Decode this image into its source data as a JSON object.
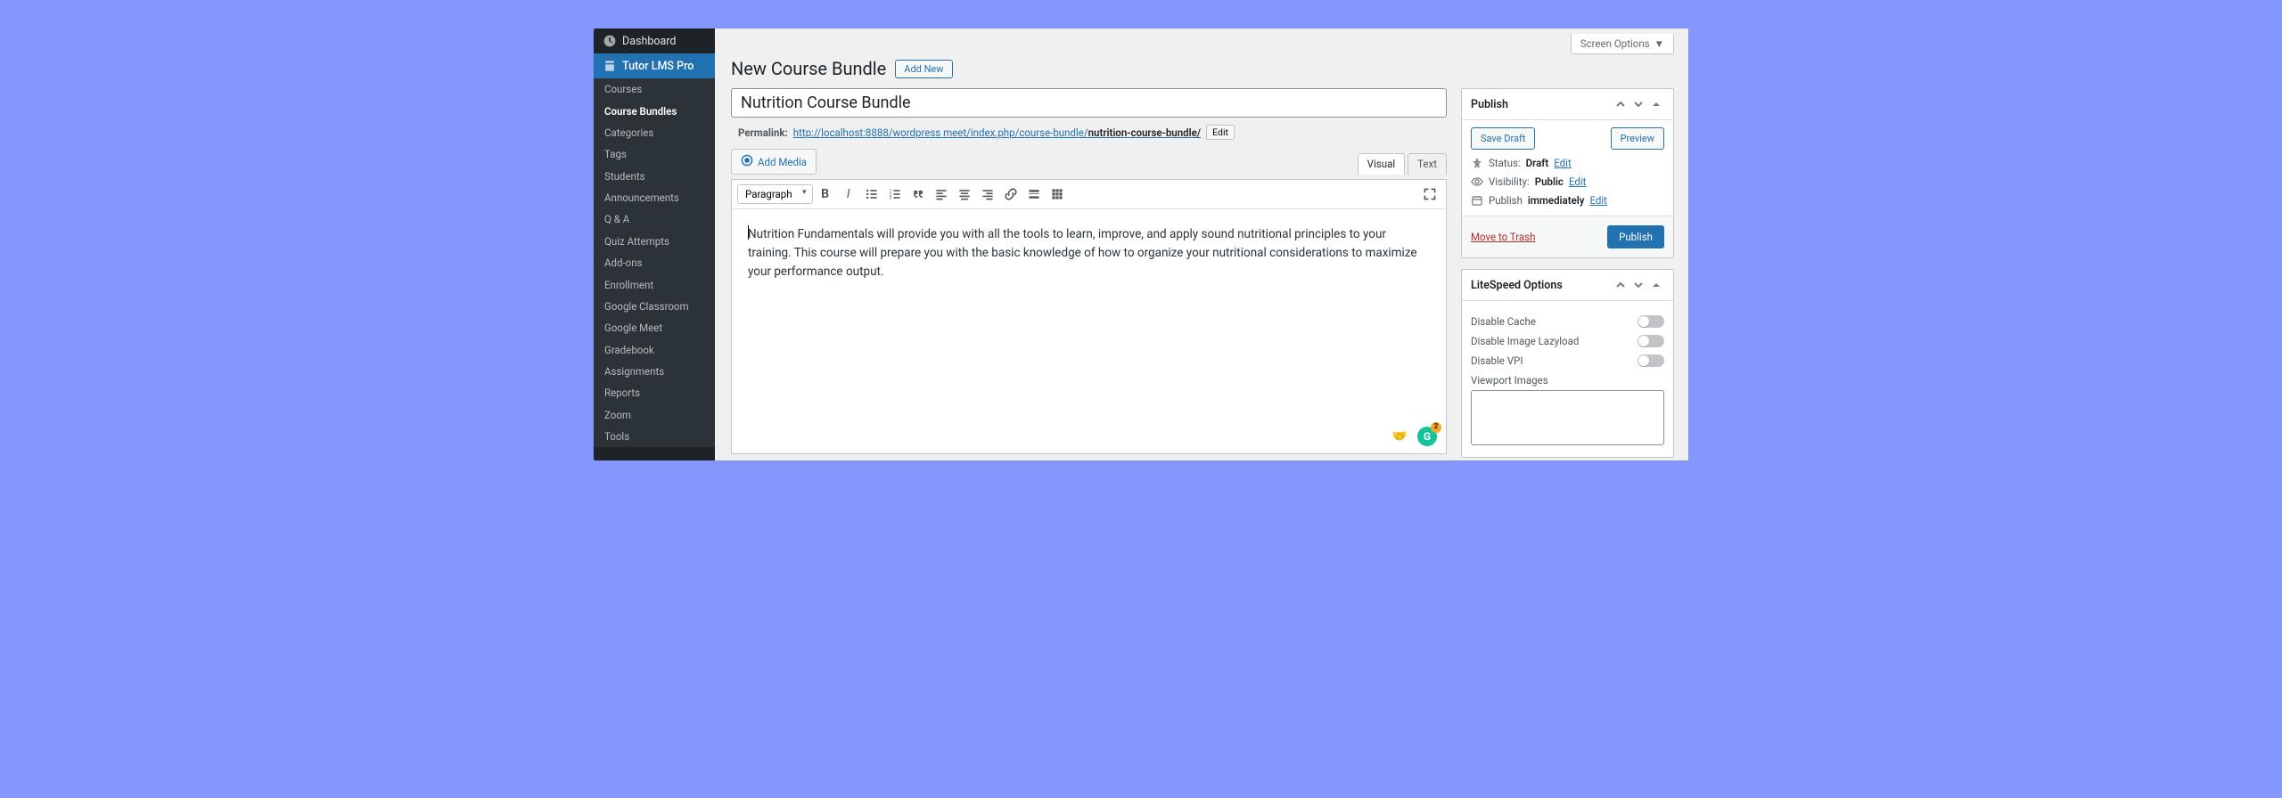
{
  "sidebar": {
    "dashboard": "Dashboard",
    "tutor": "Tutor LMS Pro",
    "items": [
      "Courses",
      "Course Bundles",
      "Categories",
      "Tags",
      "Students",
      "Announcements",
      "Q & A",
      "Quiz Attempts",
      "Add-ons",
      "Enrollment",
      "Google Classroom",
      "Google Meet",
      "Gradebook",
      "Assignments",
      "Reports",
      "Zoom",
      "Tools"
    ],
    "active_index": 1
  },
  "header": {
    "screen_options": "Screen Options",
    "page_title": "New Course Bundle",
    "add_new": "Add New"
  },
  "post": {
    "title": "Nutrition Course Bundle",
    "permalink_label": "Permalink:",
    "permalink_base": "http://localhost:8888/wordpress meet/index.php/course-bundle/",
    "permalink_slug": "nutrition-course-bundle/",
    "edit_label": "Edit",
    "add_media": "Add Media",
    "tabs": {
      "visual": "Visual",
      "text": "Text"
    },
    "format_select": "Paragraph",
    "content": "Nutrition Fundamentals will provide you with all the tools to learn, improve, and apply sound nutritional principles to your training. This course will prepare you with the basic knowledge of how to organize your nutritional considerations to maximize your performance output.",
    "grammarly_count": "2"
  },
  "publish": {
    "box_title": "Publish",
    "save_draft": "Save Draft",
    "preview": "Preview",
    "status_label": "Status:",
    "status_value": "Draft",
    "visibility_label": "Visibility:",
    "visibility_value": "Public",
    "publish_label": "Publish",
    "publish_value": "immediately",
    "edit_link": "Edit",
    "trash": "Move to Trash",
    "publish_btn": "Publish"
  },
  "litespeed": {
    "box_title": "LiteSpeed Options",
    "options": [
      "Disable Cache",
      "Disable Image Lazyload",
      "Disable VPI"
    ],
    "viewport_label": "Viewport Images"
  }
}
